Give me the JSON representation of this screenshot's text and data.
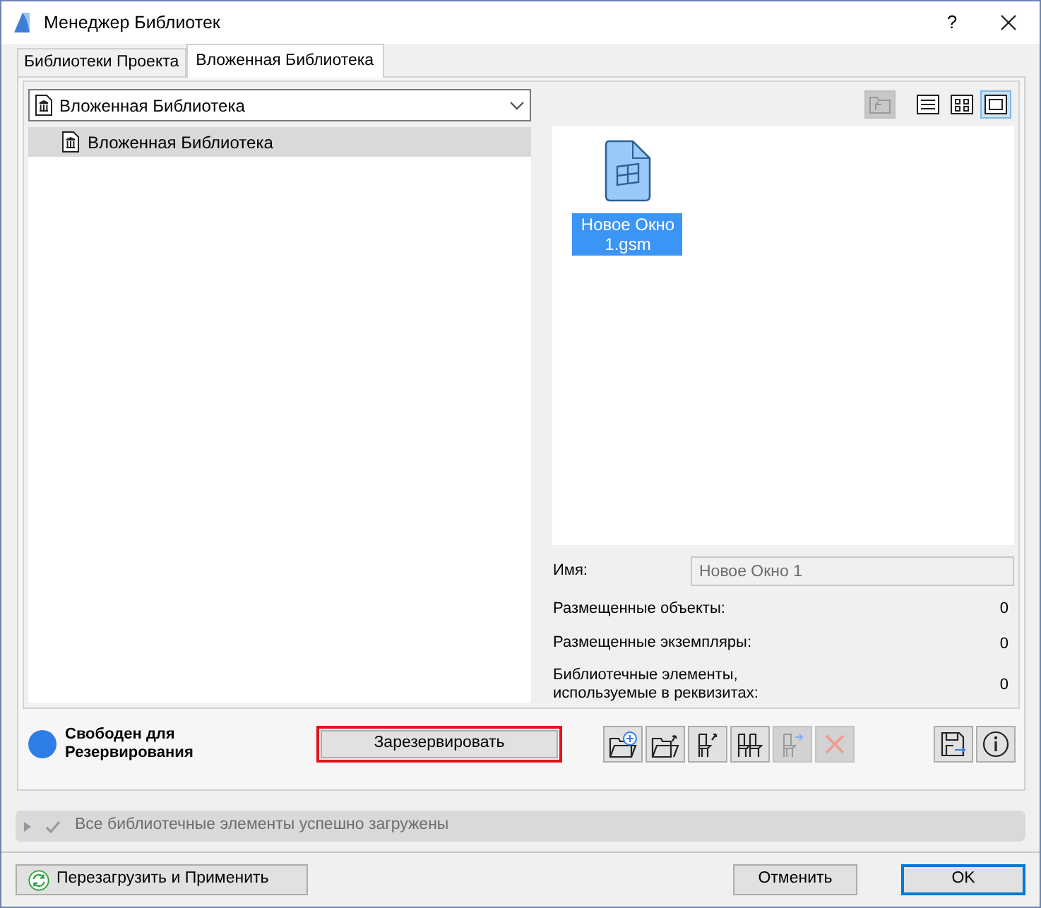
{
  "window": {
    "title": "Менеджер Библиотек",
    "help_label": "?"
  },
  "tabs": [
    {
      "label": "Библиотеки Проекта",
      "selected": false
    },
    {
      "label": "Вложенная Библиотека",
      "selected": true
    }
  ],
  "library_dropdown": {
    "value": "Вложенная Библиотека"
  },
  "tree": [
    {
      "label": "Вложенная Библиотека",
      "selected": true
    }
  ],
  "view_buttons": [
    {
      "kind": "folder-up",
      "disabled": true,
      "selected": false
    },
    {
      "kind": "list",
      "disabled": false,
      "selected": false
    },
    {
      "kind": "grid",
      "disabled": false,
      "selected": false
    },
    {
      "kind": "large",
      "disabled": false,
      "selected": true
    }
  ],
  "files": [
    {
      "name": "Новое Окно 1.gsm",
      "selected": true
    }
  ],
  "details": {
    "name_label": "Имя:",
    "name_value": "Новое Окно 1",
    "rows": [
      {
        "label": "Размещенные объекты:",
        "value": "0"
      },
      {
        "label": "Размещенные экземпляры:",
        "value": "0"
      },
      {
        "label": "Библиотечные элементы, используемые в реквизитах:",
        "value": "0"
      }
    ]
  },
  "reservation": {
    "status": "Свободен для Резервирования",
    "color": "#2f7de6",
    "button": "Зарезервировать",
    "highlighted": true
  },
  "action_buttons": [
    {
      "kind": "add-folder",
      "disabled": false
    },
    {
      "kind": "folder-export",
      "disabled": false
    },
    {
      "kind": "chair-export",
      "disabled": false
    },
    {
      "kind": "chairs",
      "disabled": false
    },
    {
      "kind": "chair-move",
      "disabled": true
    },
    {
      "kind": "delete",
      "disabled": true
    }
  ],
  "side_buttons": [
    {
      "kind": "save",
      "disabled": false
    },
    {
      "kind": "info",
      "disabled": false
    }
  ],
  "status_bar": {
    "message": "Все библиотечные элементы успешно загружены",
    "expanded": false
  },
  "footer": {
    "reload_button": "Перезагрузить и Применить",
    "cancel_button": "Отменить",
    "ok_button": "OK"
  }
}
